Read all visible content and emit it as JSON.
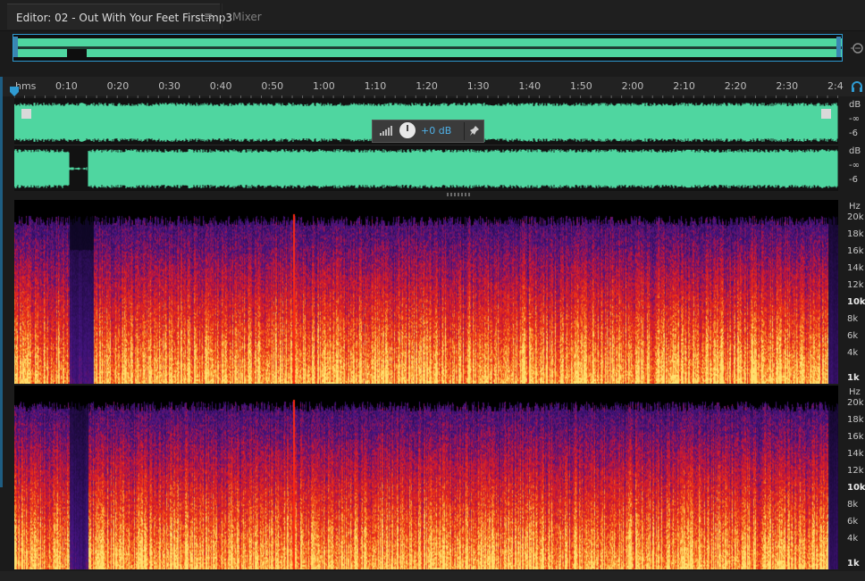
{
  "tabs": {
    "editor_label": "Editor: 02 - Out With Your Feet First.mp3",
    "editor_menu": "≡",
    "mixer_label": "Mixer"
  },
  "ruler": {
    "unit": "hms",
    "labels": [
      "0:10",
      "0:20",
      "0:30",
      "0:40",
      "0:50",
      "1:00",
      "1:10",
      "1:20",
      "1:30",
      "1:40",
      "1:50",
      "2:00",
      "2:10",
      "2:20",
      "2:30",
      "2:4"
    ]
  },
  "hud": {
    "value": "+0 dB"
  },
  "amplitude_scale": {
    "top": {
      "unit": "dB",
      "inf": "-∞",
      "six": "-6"
    },
    "bottom": {
      "unit": "dB",
      "inf": "-∞",
      "six": "-6"
    }
  },
  "frequency_scale": {
    "top": [
      "Hz",
      "20k",
      "18k",
      "16k",
      "14k",
      "12k",
      "10k",
      "8k",
      "6k",
      "4k",
      "1k"
    ],
    "bottom": [
      "Hz",
      "20k",
      "18k",
      "16k",
      "14k",
      "12k",
      "10k",
      "8k",
      "6k",
      "4k",
      "1k"
    ]
  },
  "colors": {
    "waveform": "#4fd6a0",
    "accent": "#2f9bd2",
    "spectral_low": "#ffd060",
    "spectral_mid": "#e8301a",
    "spectral_high": "#4a1a8a"
  },
  "icons": {
    "menu": "hamburger-icon",
    "zoom": "zoom-icon",
    "playhead": "playhead-icon",
    "headphones": "headphones-icon",
    "pin": "pin-icon",
    "fade_in": "fade-in-handle-icon",
    "fade_out": "fade-out-handle-icon"
  }
}
